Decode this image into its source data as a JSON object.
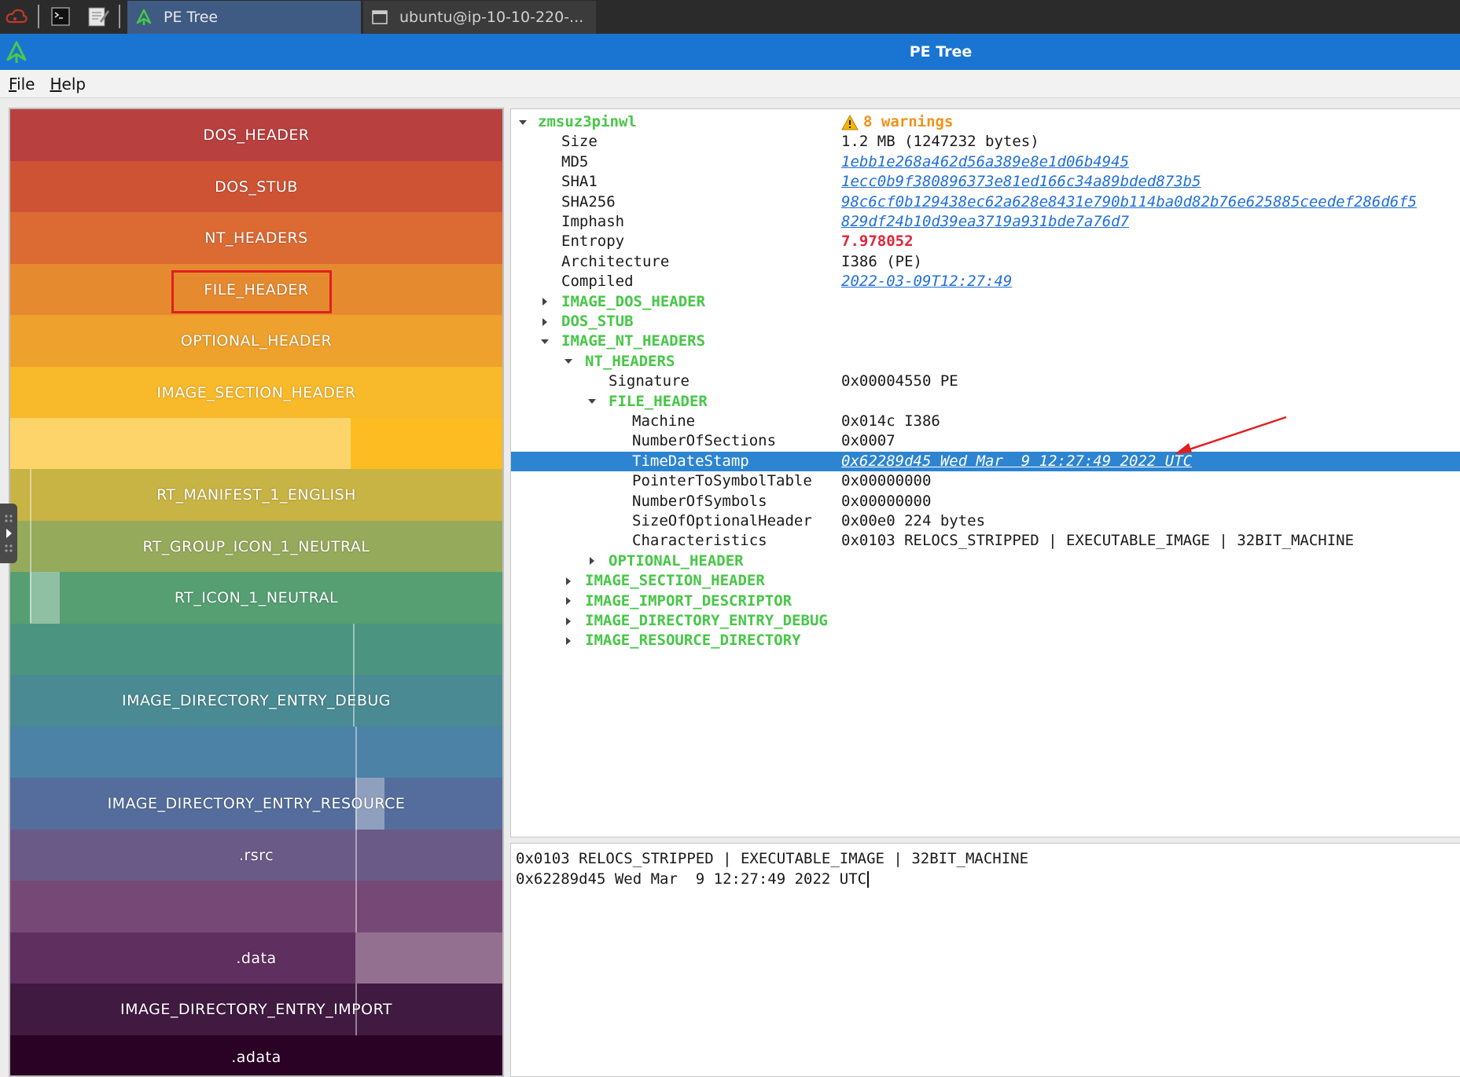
{
  "taskbar": {
    "tasks": [
      {
        "label": "PE Tree",
        "active": true
      },
      {
        "label": "ubuntu@ip-10-10-220-...",
        "active": false
      }
    ]
  },
  "window": {
    "title": "PE Tree"
  },
  "menu": {
    "file": {
      "underline": "F",
      "rest": "ile"
    },
    "help": {
      "underline": "H",
      "rest": "elp"
    }
  },
  "map": {
    "regions": [
      {
        "label": "DOS_HEADER",
        "color": "#b8403f"
      },
      {
        "label": "DOS_STUB",
        "color": "#cd5334"
      },
      {
        "label": "NT_HEADERS",
        "color": "#dc6a33"
      },
      {
        "label": "FILE_HEADER",
        "color": "#e68a2f"
      },
      {
        "label": "OPTIONAL_HEADER",
        "color": "#eea12c"
      },
      {
        "label": "IMAGE_SECTION_HEADER",
        "color": "#f8b92a"
      },
      {
        "label": "",
        "color": "#fdd46a"
      },
      {
        "label": "RT_MANIFEST_1_ENGLISH",
        "color": "#c8b345"
      },
      {
        "label": "RT_GROUP_ICON_1_NEUTRAL",
        "color": "#96aa5c"
      },
      {
        "label": "RT_ICON_1_NEUTRAL",
        "color": "#559f73"
      },
      {
        "label": "",
        "color": "#4b9580"
      },
      {
        "label": "IMAGE_DIRECTORY_ENTRY_DEBUG",
        "color": "#4a8a93"
      },
      {
        "label": "",
        "color": "#4b82a5"
      },
      {
        "label": "IMAGE_DIRECTORY_ENTRY_RESOURCE",
        "color": "#546d9c"
      },
      {
        "label": ".rsrc",
        "color": "#6a5a87"
      },
      {
        "label": "",
        "color": "#764875"
      },
      {
        "label": ".data",
        "color": "#5e2f5f"
      },
      {
        "label": "IMAGE_DIRECTORY_ENTRY_IMPORT",
        "color": "#401a41"
      },
      {
        "label": ".adata",
        "color": "#2a0226"
      }
    ]
  },
  "tree": {
    "root": {
      "name": "zmsuz3pinwl",
      "warnings": "8 warnings"
    },
    "rows": [
      {
        "key": "Size",
        "value": "1.2 MB (1247232 bytes)"
      },
      {
        "key": "MD5",
        "value": "1ebb1e268a462d56a389e8e1d06b4945"
      },
      {
        "key": "SHA1",
        "value": "1ecc0b9f380896373e81ed166c34a89bded873b5"
      },
      {
        "key": "SHA256",
        "value": "98c6cf0b129438ec62a628e8431e790b114ba0d82b76e625885ceedef286d6f5"
      },
      {
        "key": "Imphash",
        "value": "829df24b10d39ea3719a931bde7a76d7"
      },
      {
        "key": "Entropy",
        "value": "7.978052"
      },
      {
        "key": "Architecture",
        "value": "I386 (PE)"
      },
      {
        "key": "Compiled",
        "value": "2022-03-09T12:27:49"
      },
      {
        "key": "IMAGE_DOS_HEADER",
        "value": ""
      },
      {
        "key": "DOS_STUB",
        "value": ""
      },
      {
        "key": "IMAGE_NT_HEADERS",
        "value": ""
      },
      {
        "key": "NT_HEADERS",
        "value": ""
      },
      {
        "key": "Signature",
        "value": "0x00004550 PE"
      },
      {
        "key": "FILE_HEADER",
        "value": ""
      },
      {
        "key": "Machine",
        "value": "0x014c I386"
      },
      {
        "key": "NumberOfSections",
        "value": "0x0007"
      },
      {
        "key": "TimeDateStamp",
        "value": "0x62289d45 Wed Mar  9 12:27:49 2022 UTC"
      },
      {
        "key": "PointerToSymbolTable",
        "value": "0x00000000"
      },
      {
        "key": "NumberOfSymbols",
        "value": "0x00000000"
      },
      {
        "key": "SizeOfOptionalHeader",
        "value": "0x00e0 224 bytes"
      },
      {
        "key": "Characteristics",
        "value": "0x0103 RELOCS_STRIPPED | EXECUTABLE_IMAGE | 32BIT_MACHINE"
      },
      {
        "key": "OPTIONAL_HEADER",
        "value": ""
      },
      {
        "key": "IMAGE_SECTION_HEADER",
        "value": ""
      },
      {
        "key": "IMAGE_IMPORT_DESCRIPTOR",
        "value": ""
      },
      {
        "key": "IMAGE_DIRECTORY_ENTRY_DEBUG",
        "value": ""
      },
      {
        "key": "IMAGE_RESOURCE_DIRECTORY",
        "value": ""
      }
    ]
  },
  "output": {
    "lines": [
      "0x0103 RELOCS_STRIPPED | EXECUTABLE_IMAGE | 32BIT_MACHINE",
      "0x62289d45 Wed Mar  9 12:27:49 2022 UTC"
    ]
  },
  "colors": {
    "accent": "#1a74d2",
    "selection": "#2d84d0",
    "tree_green": "#47c747",
    "link": "#1f6fd8",
    "entropy_red": "#e0243a",
    "warning_orange": "#f0921a",
    "annotation_red": "#e02020"
  },
  "icons": [
    "cloud-icon",
    "terminal-icon",
    "text-editor-icon",
    "pe-tree-logo-icon",
    "window-icon",
    "warning-icon",
    "expand-arrow-icon",
    "collapse-arrow-icon"
  ]
}
